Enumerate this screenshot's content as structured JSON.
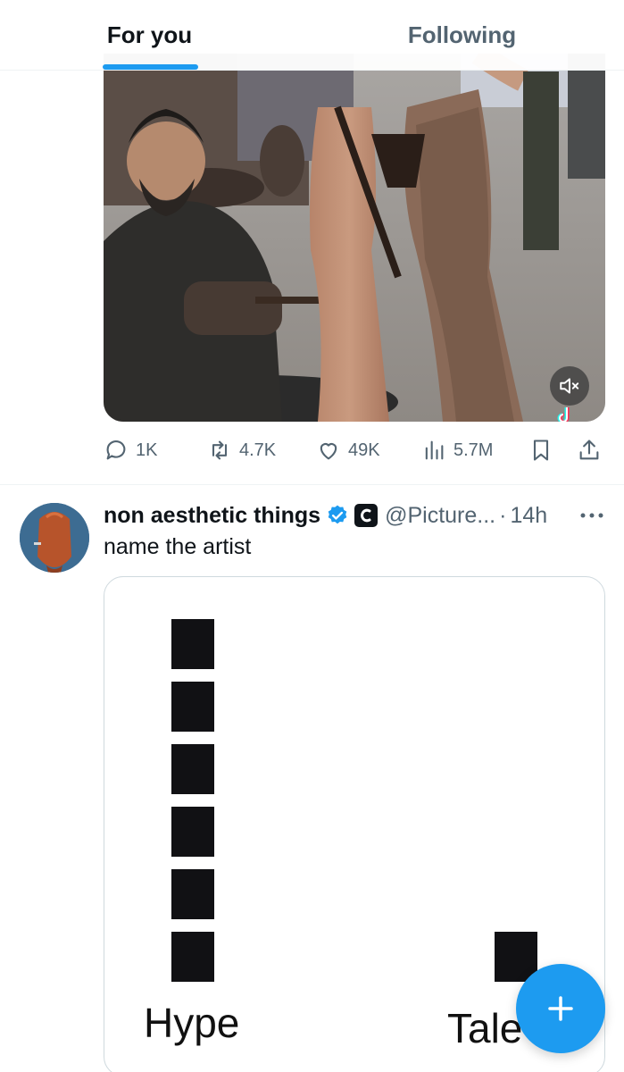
{
  "tabs": [
    {
      "label": "For you",
      "active": true
    },
    {
      "label": "Following",
      "active": false
    }
  ],
  "post1": {
    "media": {
      "description_icon": "video-thumbnail",
      "mute_icon": "speaker-muted-icon",
      "watermark_icon": "tiktok-icon"
    },
    "stats": {
      "replies": "1K",
      "reposts": "4.7K",
      "likes": "49K",
      "views": "5.7M"
    }
  },
  "post2": {
    "author": "non aesthetic things",
    "handle": "@Picture...",
    "separator": "·",
    "time": "14h",
    "text": "name the artist",
    "image": {
      "left_label": "Hype",
      "right_label": "Tale",
      "left_squares": 6,
      "right_squares": 1
    }
  },
  "colors": {
    "accent": "#1d9bf0",
    "text_primary": "#0f1419",
    "text_secondary": "#536471"
  }
}
